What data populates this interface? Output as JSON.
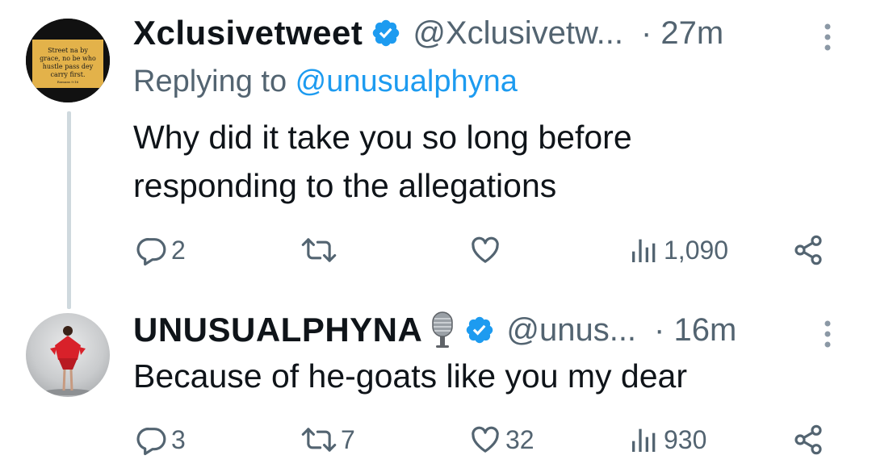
{
  "tweets": [
    {
      "display_name": "Xclusivetweet",
      "handle": "@Xclusivetw...",
      "time": "· 27m",
      "replying_to_prefix": "Replying to ",
      "replying_to_handle": "@unusualphyna",
      "avatar_text": [
        "Street na by",
        "grace, no be who",
        "hustle pass dey",
        "carry first.",
        "Romans 9:16"
      ],
      "text": "Why did it take you so long before responding to the allegations",
      "stats": {
        "replies": "2",
        "retweets": "",
        "likes": "",
        "views": "1,090"
      }
    },
    {
      "display_name": "UNUSUALPHYNA",
      "handle": "@unus...",
      "time": "· 16m",
      "text": "Because of he-goats like you my dear",
      "stats": {
        "replies": "3",
        "retweets": "7",
        "likes": "32",
        "views": "930"
      }
    }
  ],
  "icons": {
    "verified": "verified-badge-icon",
    "more": "more-vertical-icon",
    "reply": "reply-icon",
    "retweet": "retweet-icon",
    "like": "heart-icon",
    "views": "views-icon",
    "share": "share-icon",
    "microphone": "microphone-icon"
  },
  "colors": {
    "accent": "#1d9bf0",
    "muted": "#536471",
    "text": "#0f1419",
    "thread_line": "#cfd9de"
  }
}
